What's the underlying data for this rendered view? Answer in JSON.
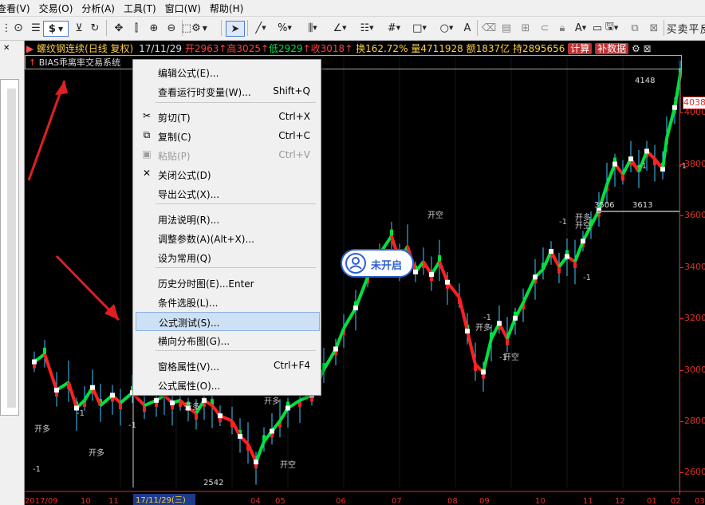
{
  "menubar": [
    "查看(V)",
    "交易(O)",
    "分析(A)",
    "工具(T)",
    "窗口(W)",
    "帮助(H)"
  ],
  "toolbar": {
    "dollar": "$",
    "pct": "%",
    "text_tool": "A",
    "right_labels": [
      "买",
      "卖",
      "平",
      "反"
    ]
  },
  "infobar": {
    "symbol": "螺纹钢连续(日线 复权)",
    "date": "17/11/29",
    "open": "开2963",
    "high": "高3025",
    "low": "低2929",
    "close": "收3018",
    "turnover": "换162.72%",
    "volume": "量4711928",
    "amount": "额1837亿",
    "position": "持2895656",
    "btn_calc": "计算",
    "btn_fill": "补数据"
  },
  "formula": {
    "arrow": "↑",
    "name": "BIAS乖离率交易系统"
  },
  "context_menu": {
    "items": [
      {
        "label": "编辑公式(E)...",
        "shortcut": "",
        "icon": "",
        "disabled": false
      },
      {
        "label": "查看运行时变量(W)...",
        "shortcut": "Shift+Q",
        "icon": "",
        "disabled": false
      },
      {
        "label": "剪切(T)",
        "shortcut": "Ctrl+X",
        "icon": "✂",
        "disabled": false
      },
      {
        "label": "复制(C)",
        "shortcut": "Ctrl+C",
        "icon": "⧉",
        "disabled": false
      },
      {
        "label": "粘贴(P)",
        "shortcut": "Ctrl+V",
        "icon": "▣",
        "disabled": true
      },
      {
        "label": "关闭公式(D)",
        "shortcut": "",
        "icon": "✕",
        "disabled": false
      },
      {
        "label": "导出公式(X)...",
        "shortcut": "",
        "icon": "",
        "disabled": false
      },
      {
        "label": "用法说明(R)...",
        "shortcut": "",
        "icon": "",
        "disabled": false
      },
      {
        "label": "调整参数(A)(Alt+X)...",
        "shortcut": "",
        "icon": "",
        "disabled": false
      },
      {
        "label": "设为常用(Q)",
        "shortcut": "",
        "icon": "",
        "disabled": false
      },
      {
        "label": "历史分时图(E)...Enter",
        "shortcut": "",
        "icon": "",
        "disabled": false
      },
      {
        "label": "条件选股(L)...",
        "shortcut": "",
        "icon": "",
        "disabled": false
      },
      {
        "label": "公式测试(S)...",
        "shortcut": "",
        "icon": "",
        "disabled": false,
        "selected": true
      },
      {
        "label": "横向分布图(G)...",
        "shortcut": "",
        "icon": "",
        "disabled": false
      },
      {
        "label": "窗格属性(V)...",
        "shortcut": "Ctrl+F4",
        "icon": "",
        "disabled": false
      },
      {
        "label": "公式属性(O)...",
        "shortcut": "",
        "icon": "",
        "disabled": false
      }
    ]
  },
  "badge": {
    "label": "未开启",
    "icon": "user-circle-icon"
  },
  "price_axis": {
    "labels": [
      "4000",
      "3800",
      "3600",
      "3400",
      "3200",
      "3000",
      "2800",
      "2600"
    ],
    "current": "4038",
    "color": "#e0302a"
  },
  "annotations": {
    "top": "4148",
    "low": "2542",
    "mid_a": "3506",
    "mid_b": "3613"
  },
  "signals": {
    "buy": "开多",
    "sell": "开空",
    "minus": "-1"
  },
  "date_axis": {
    "current": "17/11/29(三)",
    "labels": [
      "2017/09",
      "10",
      "11",
      "",
      "",
      "04",
      "05",
      "06",
      "07",
      "08",
      "09",
      "10",
      "11",
      "12",
      "01",
      "02",
      "03"
    ]
  },
  "colors": {
    "up": "#ff2020",
    "down": "#00e040",
    "wick": "#40c8ff",
    "accent": "#2d5fd0"
  }
}
